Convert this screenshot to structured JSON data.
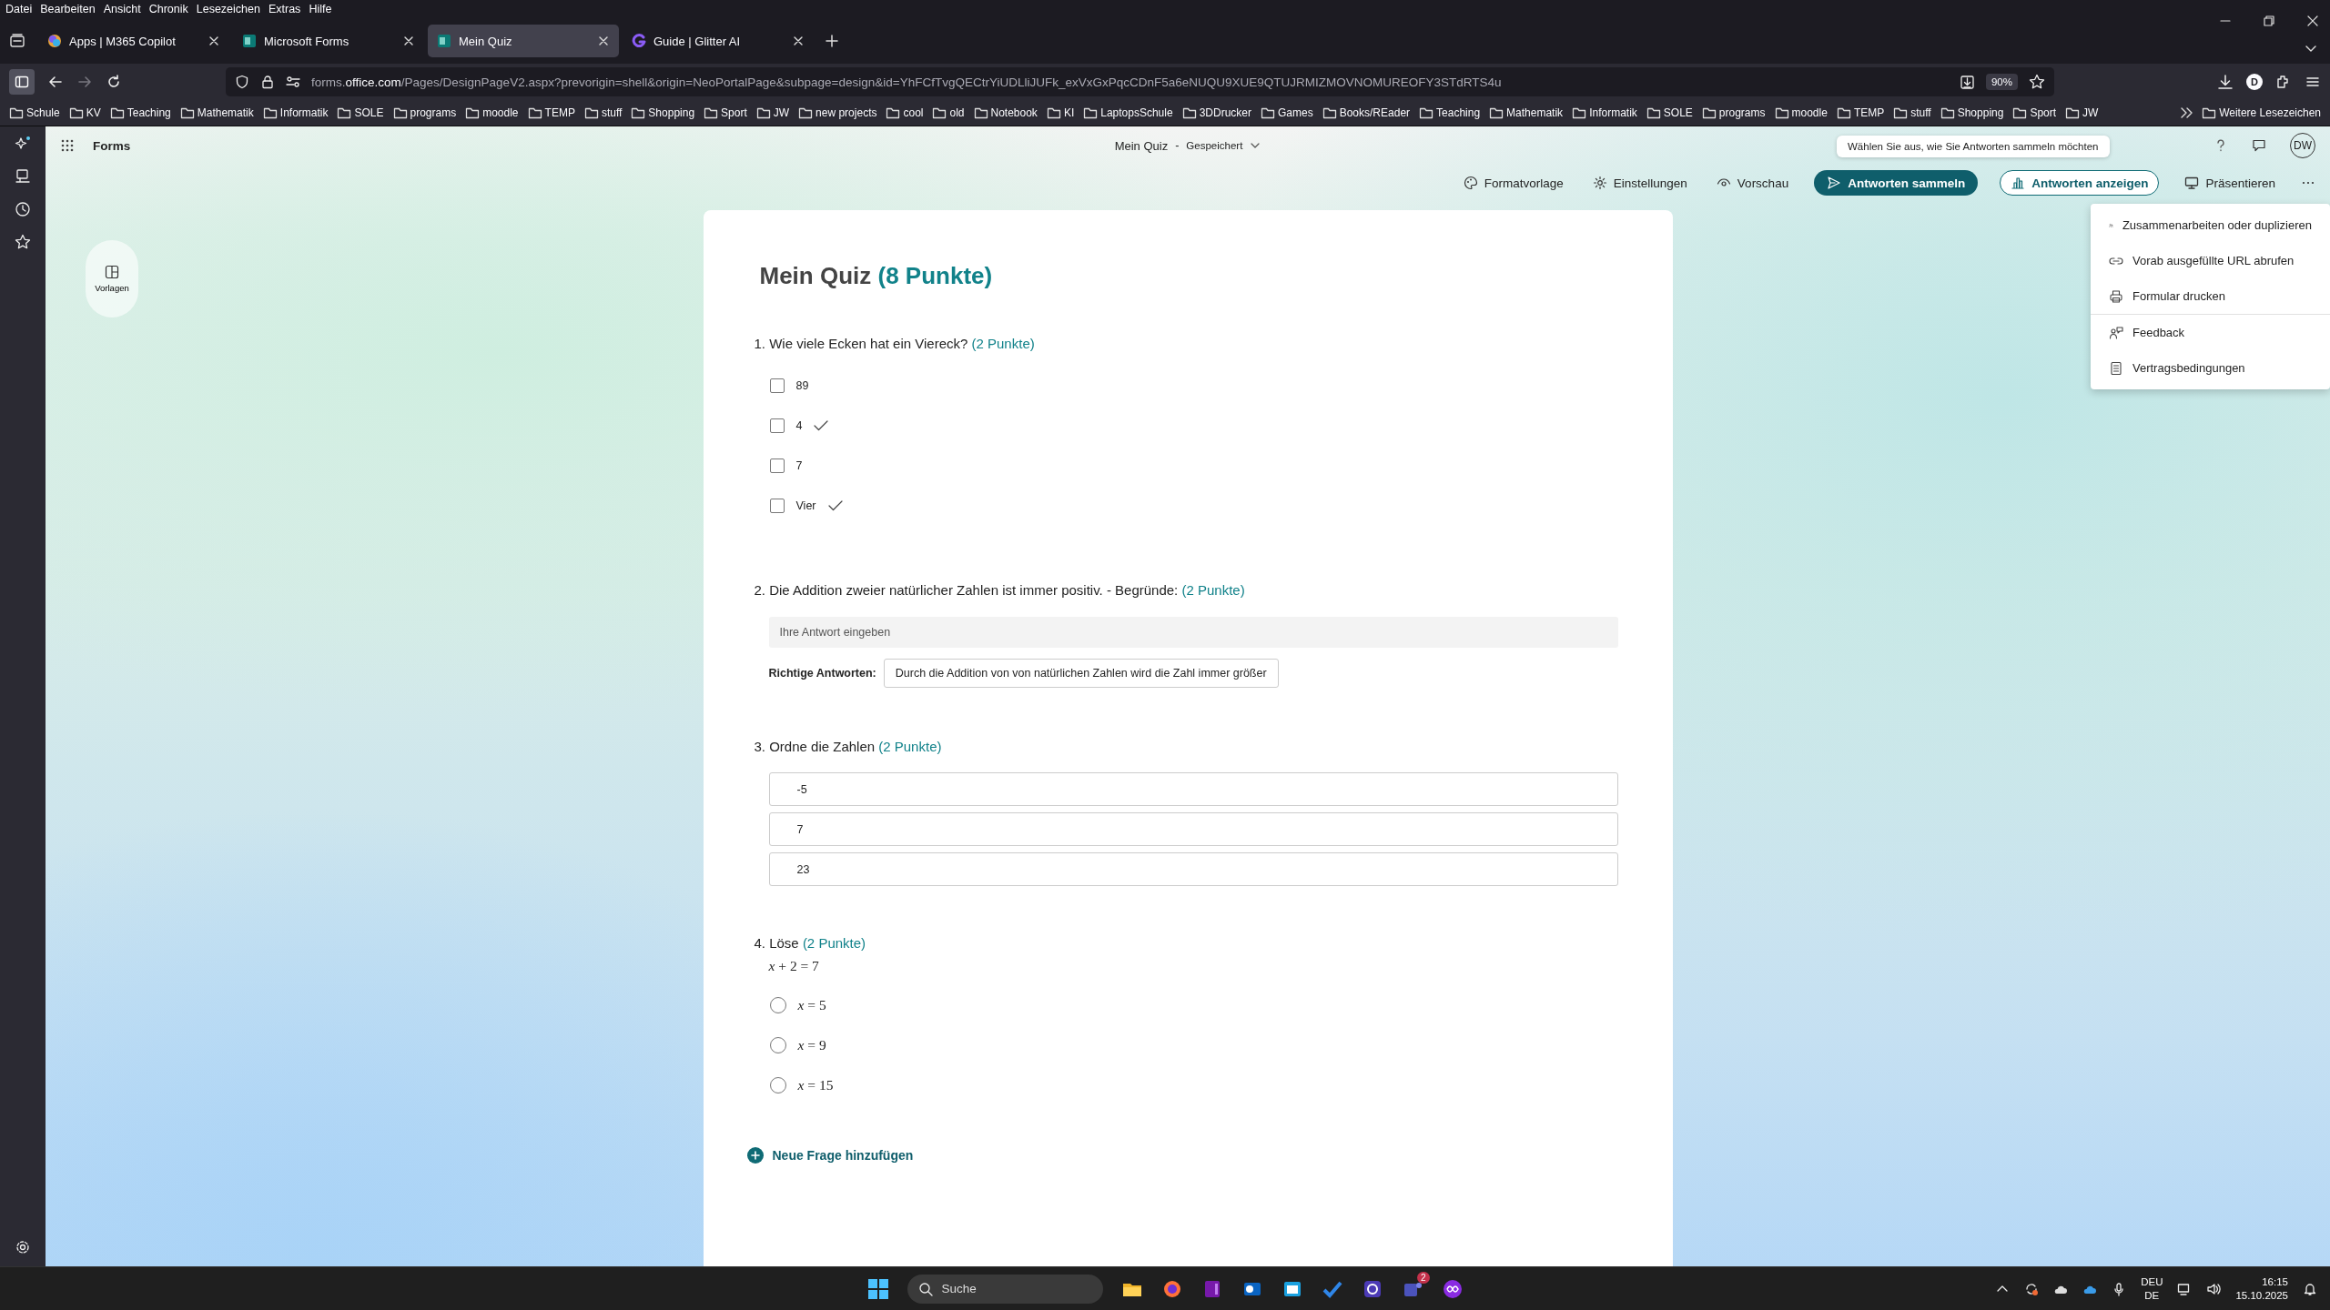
{
  "menu_bar": [
    "Datei",
    "Bearbeiten",
    "Ansicht",
    "Chronik",
    "Lesezeichen",
    "Extras",
    "Hilfe"
  ],
  "tabs": [
    {
      "label": "Apps | M365 Copilot",
      "selected": false
    },
    {
      "label": "Microsoft Forms",
      "selected": false
    },
    {
      "label": "Mein Quiz",
      "selected": true
    },
    {
      "label": "Guide | Glitter AI",
      "selected": false
    }
  ],
  "address": {
    "subdomain": "forms.",
    "domain": "office.com",
    "path": "/Pages/DesignPageV2.aspx?prevorigin=shell&origin=NeoPortalPage&subpage=design&id=YhFCfTvgQECtrYiUDLliJUFk_exVxGxPqcCDnF5a6eNUQU9XUE9QTUJRMIZMOVNOMUREOFY3STdRTS4u",
    "zoom": "90%",
    "profile": "D"
  },
  "bookmarks": [
    "Schule",
    "KV",
    "Teaching",
    "Mathematik",
    "Informatik",
    "SOLE",
    "programs",
    "moodle",
    "TEMP",
    "stuff",
    "Shopping",
    "Sport",
    "JW",
    "new projects",
    "cool",
    "old",
    "Notebook",
    "KI",
    "LaptopsSchule",
    "3DDrucker",
    "Games",
    "Books/REader",
    "Teaching",
    "Mathematik",
    "Informatik",
    "SOLE",
    "programs",
    "moodle",
    "TEMP",
    "stuff",
    "Shopping",
    "Sport",
    "JW"
  ],
  "more_bookmarks": "Weitere Lesezeichen",
  "app": {
    "name": "Forms",
    "doc_title": "Mein Quiz",
    "separator": "-",
    "save_status": "Gespeichert",
    "avatar": "DW",
    "tooltip": "Wählen Sie aus, wie Sie Antworten sammeln möchten",
    "templates": "Vorlagen"
  },
  "toolbar": [
    {
      "label": "Formatvorlage",
      "kind": "plain"
    },
    {
      "label": "Einstellungen",
      "kind": "plain"
    },
    {
      "label": "Vorschau",
      "kind": "plain"
    },
    {
      "label": "Antworten sammeln",
      "kind": "primary"
    },
    {
      "label": "Antworten anzeigen",
      "kind": "outline"
    },
    {
      "label": "Präsentieren",
      "kind": "plain"
    }
  ],
  "more_menu": [
    {
      "label": "Zusammenarbeiten oder duplizieren",
      "divider_before": false
    },
    {
      "label": "Vorab ausgefüllte URL abrufen",
      "divider_before": false
    },
    {
      "label": "Formular drucken",
      "divider_before": false
    },
    {
      "label": "Feedback",
      "divider_before": true
    },
    {
      "label": "Vertragsbedingungen",
      "divider_before": false
    }
  ],
  "quiz": {
    "title": "Mein Quiz",
    "points": "(8 Punkte)",
    "questions": [
      {
        "kind": "checkbox",
        "number": "1.",
        "text": "Wie viele Ecken hat ein Viereck?",
        "points": "(2 Punkte)",
        "options": [
          {
            "label": "89",
            "checked": false,
            "correct": false
          },
          {
            "label": "4",
            "checked": false,
            "correct": true
          },
          {
            "label": "7",
            "checked": false,
            "correct": false
          },
          {
            "label": "Vier",
            "checked": false,
            "correct": true
          }
        ]
      },
      {
        "kind": "text",
        "number": "2.",
        "text": "Die Addition zweier natürlicher Zahlen ist immer positiv. - Begründe:",
        "points": "(2 Punkte)",
        "placeholder": "Ihre Antwort eingeben",
        "answer_label": "Richtige Antworten:",
        "answer": "Durch die Addition von von natürlichen Zahlen wird die Zahl immer größer"
      },
      {
        "kind": "ranking",
        "number": "3.",
        "text": "Ordne die Zahlen",
        "points": "(2 Punkte)",
        "items": [
          "-5",
          "7",
          "23"
        ]
      },
      {
        "kind": "radio",
        "number": "4.",
        "text": "Löse",
        "points": "(2 Punkte)",
        "formula": "*x* + 2 = 7",
        "options": [
          {
            "label": "*x* = 5",
            "selected": false
          },
          {
            "label": "*x* = 9",
            "selected": false
          },
          {
            "label": "*x* = 15",
            "selected": false
          }
        ]
      }
    ],
    "add_question": "Neue Frage hinzufügen"
  },
  "taskbar": {
    "search": "Suche",
    "badge": "2",
    "language": "DEU",
    "region": "DE",
    "time": "16:15",
    "date": "15.10.2025"
  }
}
